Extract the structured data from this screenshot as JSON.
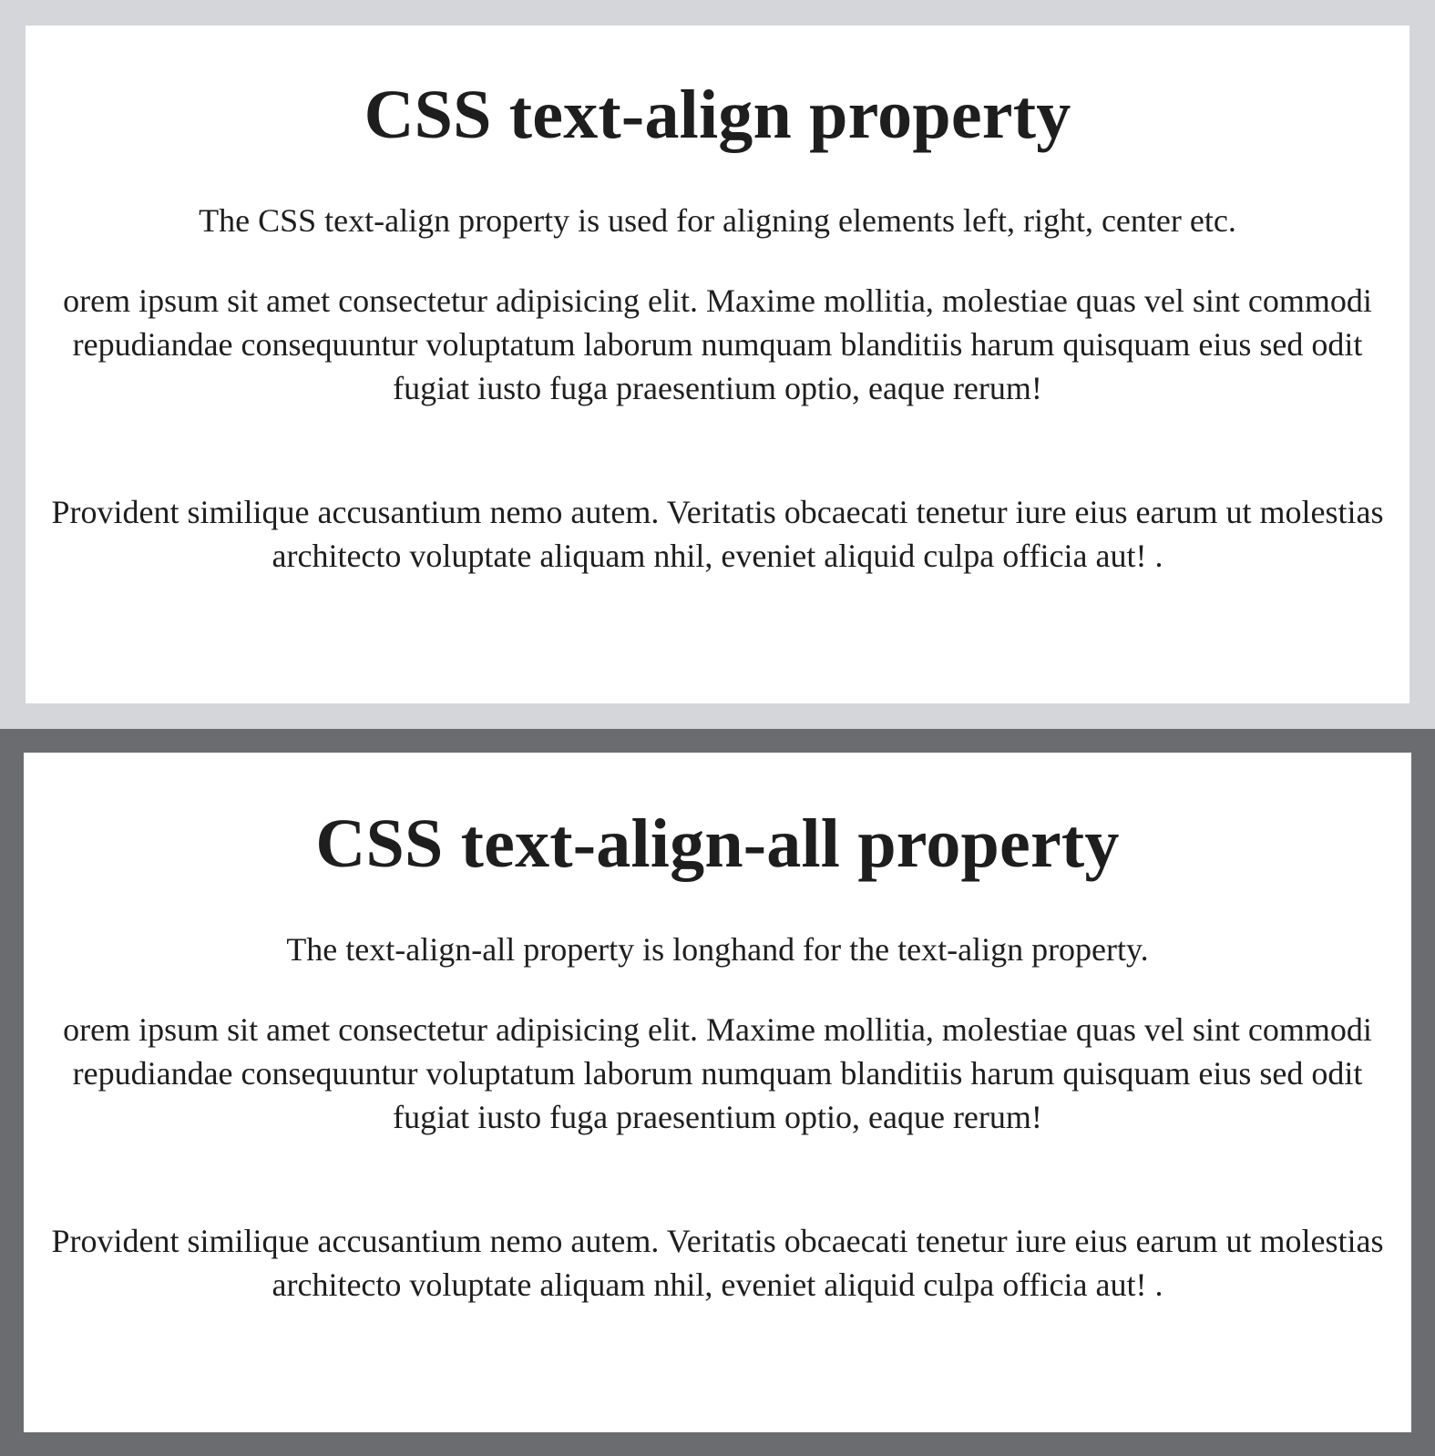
{
  "sections": [
    {
      "heading": "CSS text-align property",
      "intro": "The CSS text-align property is used for aligning elements left, right, center etc.",
      "paragraph1": "orem ipsum sit amet consectetur adipisicing elit. Maxime mollitia, molestiae quas vel sint commodi repudiandae consequuntur voluptatum laborum numquam blanditiis harum quisquam eius sed odit fugiat iusto fuga praesentium optio, eaque rerum!",
      "paragraph2": "Provident similique accusantium nemo autem. Veritatis obcaecati tenetur iure eius earum ut molestias architecto voluptate aliquam nhil, eveniet aliquid culpa officia aut! ."
    },
    {
      "heading": "CSS text-align-all property",
      "intro": "The text-align-all property is longhand for the text-align property.",
      "paragraph1": "orem ipsum sit amet consectetur adipisicing elit. Maxime mollitia, molestiae quas vel sint commodi repudiandae consequuntur voluptatum laborum numquam blanditiis harum quisquam eius sed odit fugiat iusto fuga praesentium optio, eaque rerum!",
      "paragraph2": "Provident similique accusantium nemo autem. Veritatis obcaecati tenetur iure eius earum ut molestias architecto voluptate aliquam nhil, eveniet aliquid culpa officia aut! ."
    }
  ],
  "colors": {
    "top_border": "#d4d6d9",
    "bottom_border": "#6b6c70",
    "text": "#1e1e1e",
    "background": "#ffffff"
  }
}
